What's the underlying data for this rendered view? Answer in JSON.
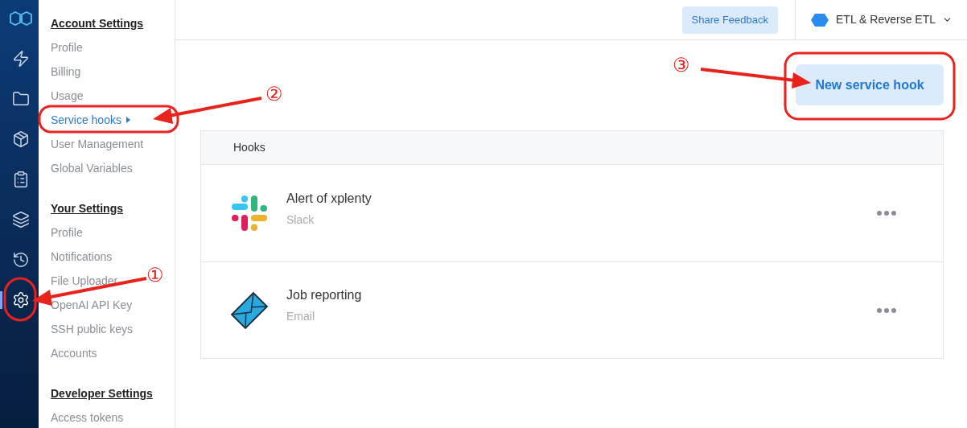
{
  "rail": [
    {
      "kind": "logo",
      "selected": false
    },
    {
      "kind": "zap",
      "selected": false
    },
    {
      "kind": "folder",
      "selected": false
    },
    {
      "kind": "package",
      "selected": false
    },
    {
      "kind": "clipboard",
      "selected": false
    },
    {
      "kind": "layers",
      "selected": false
    },
    {
      "kind": "history",
      "selected": false
    },
    {
      "kind": "settings",
      "selected": true
    }
  ],
  "sidebar": {
    "sections": [
      {
        "title": "Account Settings",
        "items": [
          {
            "label": "Profile",
            "selected": false
          },
          {
            "label": "Billing",
            "selected": false
          },
          {
            "label": "Usage",
            "selected": false
          },
          {
            "label": "Service hooks",
            "selected": true
          },
          {
            "label": "User Management",
            "selected": false
          },
          {
            "label": "Global Variables",
            "selected": false
          }
        ]
      },
      {
        "title": "Your Settings",
        "items": [
          {
            "label": "Profile",
            "selected": false
          },
          {
            "label": "Notifications",
            "selected": false
          },
          {
            "label": "File Uploader",
            "selected": false
          },
          {
            "label": "OpenAI API Key",
            "selected": false
          },
          {
            "label": "SSH public keys",
            "selected": false
          },
          {
            "label": "Accounts",
            "selected": false
          }
        ]
      },
      {
        "title": "Developer Settings",
        "items": [
          {
            "label": "Access tokens",
            "selected": false
          }
        ]
      }
    ]
  },
  "topbar": {
    "feedback_button": "Share Feedback",
    "product": "ETL & Reverse ETL"
  },
  "new_button": "New service hook",
  "hooks": {
    "header": "Hooks",
    "rows": [
      {
        "name": "Alert of xplenty",
        "type": "Slack",
        "kind": "slack"
      },
      {
        "name": "Job reporting",
        "type": "Email",
        "kind": "email"
      }
    ]
  },
  "annotations": [
    {
      "number": "①"
    },
    {
      "number": "②"
    },
    {
      "number": "③"
    }
  ]
}
